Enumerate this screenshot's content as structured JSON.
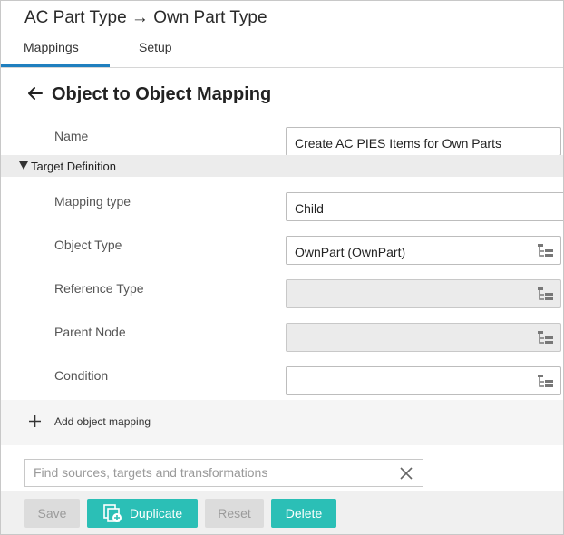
{
  "header": {
    "title": "AC Part Type → Own Part Type",
    "tabs": [
      {
        "label": "Mappings",
        "active": true
      },
      {
        "label": "Setup",
        "active": false
      }
    ]
  },
  "page": {
    "heading": "Object to Object Mapping",
    "back_icon": "arrow-left-icon"
  },
  "form": {
    "name": {
      "label": "Name",
      "value": "Create AC PIES Items for Own Parts"
    },
    "section": {
      "title": "Target Definition",
      "expanded": true
    },
    "mapping_type": {
      "label": "Mapping type",
      "value": "Child"
    },
    "object_type": {
      "label": "Object Type",
      "value": "OwnPart (OwnPart)"
    },
    "reference_type": {
      "label": "Reference Type",
      "value": "",
      "disabled": true
    },
    "parent_node": {
      "label": "Parent Node",
      "value": "",
      "disabled": true
    },
    "condition": {
      "label": "Condition",
      "value": ""
    }
  },
  "actions": {
    "add_mapping_label": "Add object mapping"
  },
  "search": {
    "placeholder": "Find sources, targets and transformations",
    "value": ""
  },
  "toolbar": {
    "save_label": "Save",
    "duplicate_label": "Duplicate",
    "reset_label": "Reset",
    "delete_label": "Delete"
  },
  "colors": {
    "accent": "#2bbfb6",
    "tab_underline": "#1f7fbf",
    "disabled_field": "#ebebeb"
  }
}
